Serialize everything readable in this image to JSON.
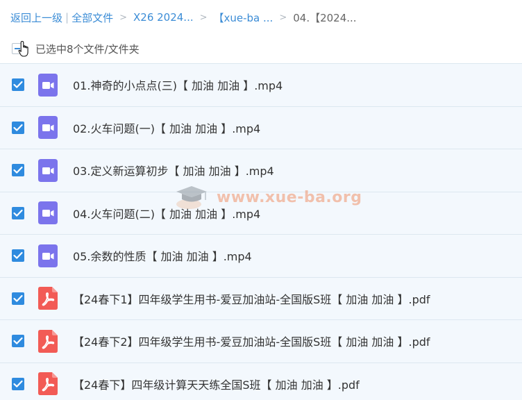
{
  "breadcrumb": {
    "back": "返回上一级",
    "divider": "|",
    "all_files": "全部文件",
    "separator": ">",
    "path": [
      "X26 2024...",
      "【xue-ba ...",
      "04.【2024..."
    ]
  },
  "selection": {
    "text": "已选中8个文件/文件夹"
  },
  "files": [
    {
      "name": "01.神奇的小点点(三)【 加油 加油 】.mp4",
      "type": "video-icon",
      "checked": true
    },
    {
      "name": "02.火车问题(一)【 加油 加油 】.mp4",
      "type": "video-icon",
      "checked": true
    },
    {
      "name": "03.定义新运算初步【 加油 加油 】.mp4",
      "type": "video-icon",
      "checked": true
    },
    {
      "name": "04.火车问题(二)【 加油 加油 】.mp4",
      "type": "video-icon",
      "checked": true
    },
    {
      "name": "05.余数的性质【 加油 加油 】.mp4",
      "type": "video-icon",
      "checked": true
    },
    {
      "name": "【24春下1】四年级学生用书-爱豆加油站-全国版S班【 加油 加油 】.pdf",
      "type": "pdf-icon",
      "checked": true
    },
    {
      "name": "【24春下2】四年级学生用书-爱豆加油站-全国版S班【 加油 加油 】.pdf",
      "type": "pdf-icon",
      "checked": true
    },
    {
      "name": "【24春下】四年级计算天天练全国S班【 加油 加油 】.pdf",
      "type": "pdf-icon",
      "checked": true
    }
  ],
  "watermark": {
    "text": "www.xue-ba.org"
  },
  "colors": {
    "accent": "#2f8bdf",
    "link": "#3b8cd6",
    "row_bg": "#f3f8fd",
    "video_icon": "#7b74ec",
    "pdf_icon": "#f25b55"
  }
}
